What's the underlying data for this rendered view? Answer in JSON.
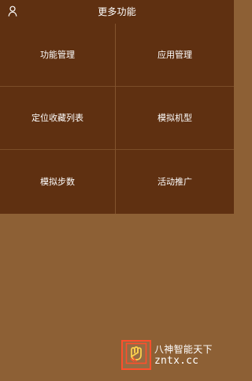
{
  "header": {
    "title": "更多功能",
    "user_icon": "user-icon"
  },
  "menu": {
    "items": [
      {
        "label": "功能管理"
      },
      {
        "label": "应用管理"
      },
      {
        "label": "定位收藏列表"
      },
      {
        "label": "模拟机型"
      },
      {
        "label": "模拟步数"
      },
      {
        "label": "活动推广"
      }
    ]
  },
  "watermark": {
    "line1": "八神智能天下",
    "line2": "zntx.cc",
    "accent_color": "#ff4f2c"
  },
  "colors": {
    "header_bg": "#5f3011",
    "page_bg": "#8d6035",
    "text": "#ffffff"
  }
}
